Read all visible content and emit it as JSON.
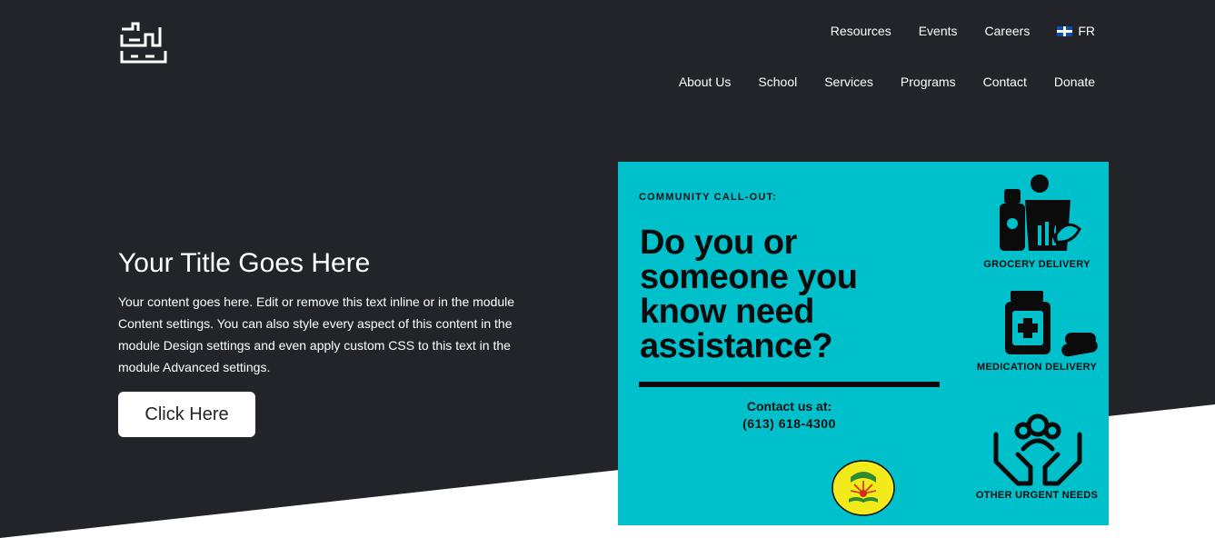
{
  "nav": {
    "top": [
      "Resources",
      "Events",
      "Careers"
    ],
    "lang": {
      "code": "FR",
      "icon": "quebec-flag-icon"
    },
    "main": [
      "About Us",
      "School",
      "Services",
      "Programs",
      "Contact",
      "Donate"
    ]
  },
  "hero": {
    "title": "Your Title Goes Here",
    "text": "Your content goes here. Edit or remove this text inline or in the module Content settings. You can also style every aspect of this content in the module Design settings and even apply custom CSS to this text in the module Advanced settings.",
    "button": "Click Here"
  },
  "poster": {
    "callout": "COMMUNITY CALL-OUT:",
    "headline": "Do you or someone you know need assistance?",
    "contact_label": "Contact us at:",
    "contact_phone": "(613) 618-4300",
    "services": [
      {
        "label": "GROCERY DELIVERY",
        "icon": "grocery-bag-icon"
      },
      {
        "label": "MEDICATION DELIVERY",
        "icon": "medicine-bottle-icon"
      },
      {
        "label": "OTHER URGENT NEEDS",
        "icon": "helping-hands-icon"
      }
    ]
  },
  "colors": {
    "dark_bg": "#222429",
    "poster_bg": "#00c1cb",
    "text_light": "#ffffff"
  }
}
